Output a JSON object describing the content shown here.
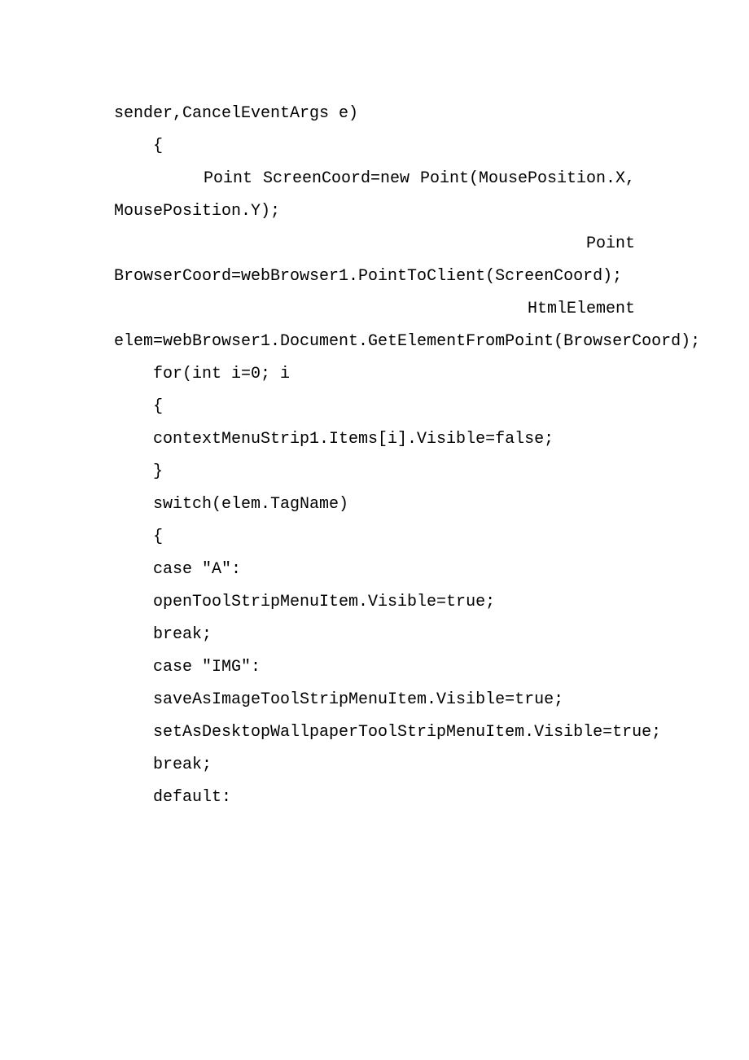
{
  "code": {
    "line1": "sender,CancelEventArgs e)",
    "line2": "{",
    "line3_tokens": [
      "Point",
      "ScreenCoord=new",
      "Point(MousePosition.X,"
    ],
    "line4": "MousePosition.Y);",
    "line5_right": "Point",
    "line6": "BrowserCoord=webBrowser1.PointToClient(ScreenCoord);",
    "line7_right": "HtmlElement",
    "line8": "elem=webBrowser1.Document.GetElementFromPoint(BrowserCoord);",
    "line9": "for(int i=0; i",
    "line10": "{",
    "line11": "contextMenuStrip1.Items[i].Visible=false;",
    "line12": "}",
    "line13": "switch(elem.TagName)",
    "line14": "{",
    "line15": "case \"A\":",
    "line16": "openToolStripMenuItem.Visible=true;",
    "line17": "break;",
    "line18": "case \"IMG\":",
    "line19": "saveAsImageToolStripMenuItem.Visible=true;",
    "line20": "setAsDesktopWallpaperToolStripMenuItem.Visible=true;",
    "line21": "break;",
    "line22": "default:"
  }
}
